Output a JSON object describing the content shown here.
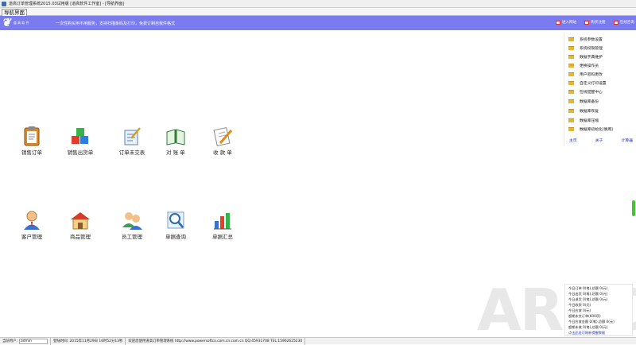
{
  "window": {
    "title": "道高订单管理系统2015.03试用版 [道高软件工作室] - [导航界面]"
  },
  "tab": {
    "label": "导航界面"
  },
  "banner": {
    "logo_text": "道 高 软 件",
    "slogan": "一次性购买用不用服务，支持扫描条码及打印，免费订制自我件格式",
    "links": [
      "进入网站",
      "购买注册",
      "在线咨询"
    ]
  },
  "nav_row1": [
    "销售订单",
    "销售出货单",
    "订单未交表",
    "对 账 单",
    "收 款 单"
  ],
  "nav_row2": [
    "客户管理",
    "商品管理",
    "员工管理",
    "单据查询",
    "单据汇总"
  ],
  "side": {
    "items": [
      "系统参数设置",
      "系统权限管理",
      "数据字典维护",
      "更换操作员",
      "用户密码更改",
      "自定义打印设置",
      "在线提醒中心",
      "数据库备份",
      "数据库恢复",
      "数据库压缩",
      "数据库初始化(慎用)"
    ],
    "bottom": [
      "主页",
      "关于",
      "计算器"
    ]
  },
  "stats": {
    "lines": [
      "今日订单 0(笔),总额 0(元)",
      "今日出货 0(笔),总额 0(元)",
      "今日退货 0(笔),总额 0(元)",
      "今日收款 0(元)",
      "今日应收 0(元)",
      "超期未交订单(600项)",
      "今日应收金额 0(笔),总额 0(元)",
      "超期未收 0(笔),总额 0(元)"
    ],
    "link": "点击此处可刷新提醒数据"
  },
  "status": {
    "user_label": "当前用户:",
    "user_value": "admin",
    "login_time": "登陆时间: 2015年11月29日 16时52分13秒",
    "welcome": "欢迎您使用道高订单管理系统 http://www.powersoftco.com.cn.com.cn QQ:45931708 TEL:15962625230"
  },
  "watermark": "ARPC",
  "colors": {
    "banner": "#7b7bf0",
    "folder": "#e8b628",
    "link": "#2233aa"
  }
}
